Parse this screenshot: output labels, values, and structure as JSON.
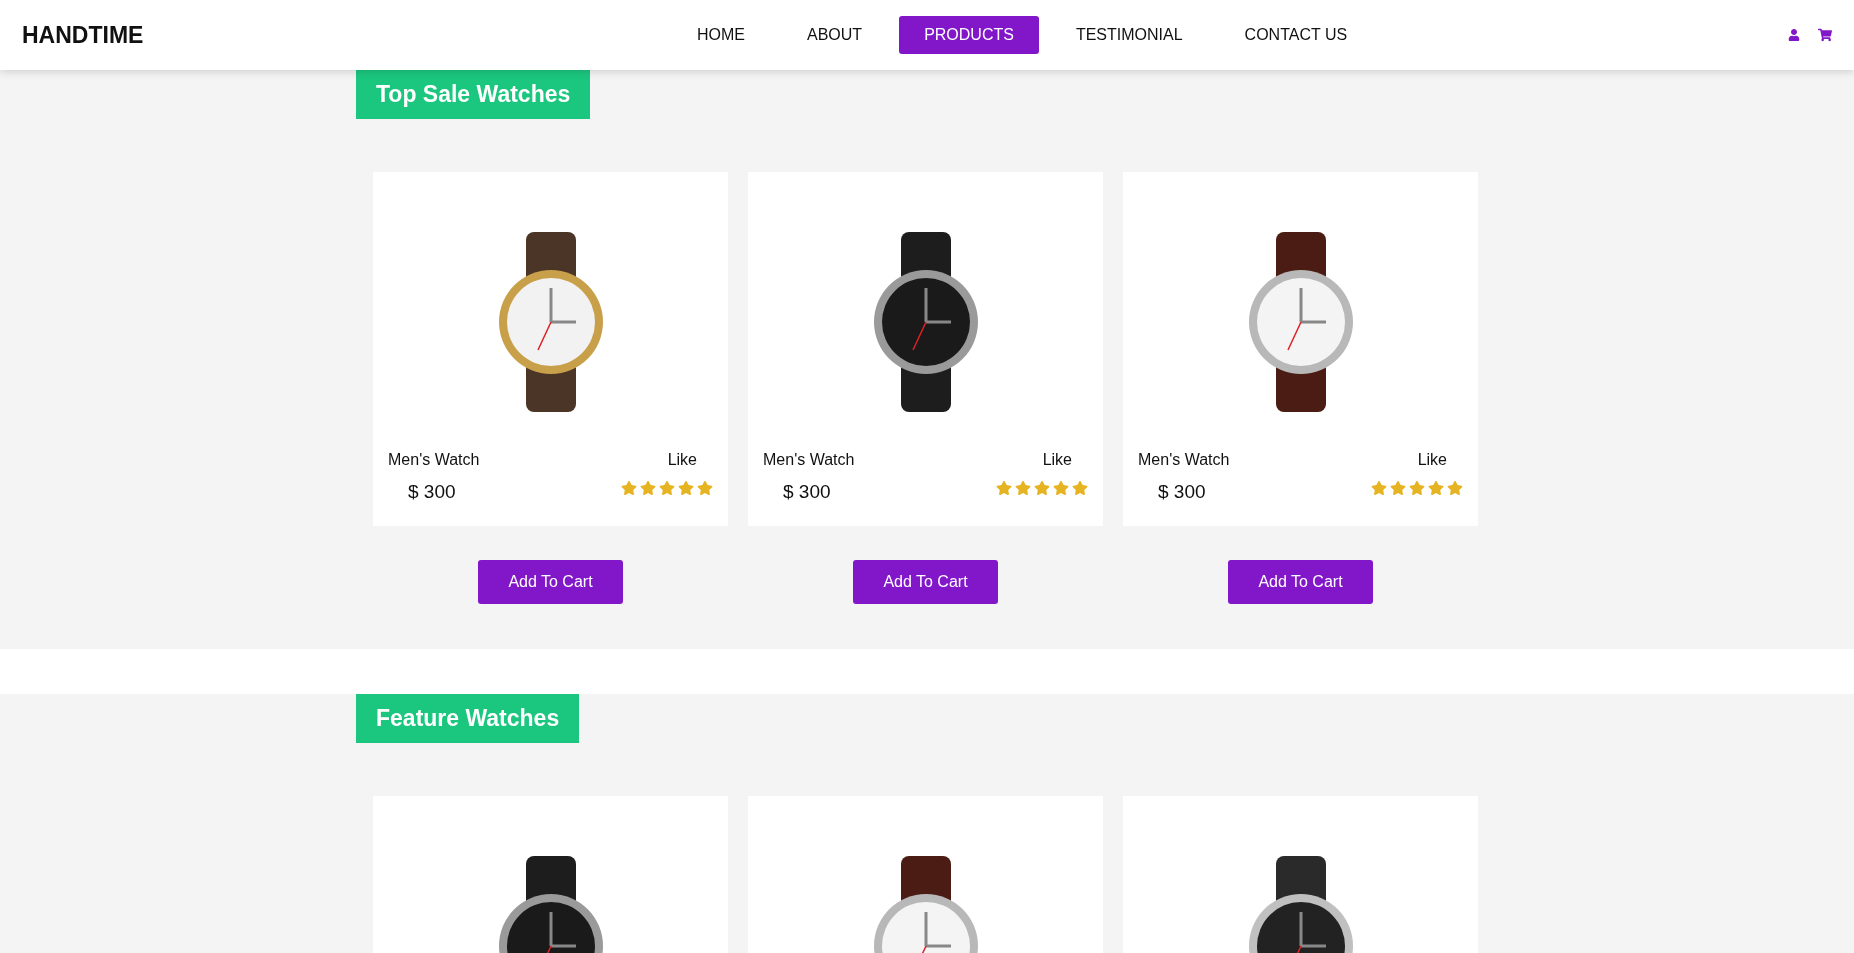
{
  "header": {
    "logo": "HANDTIME",
    "nav": [
      {
        "label": "HOME",
        "selected": false
      },
      {
        "label": "ABOUT",
        "selected": false
      },
      {
        "label": "PRODUCTS",
        "selected": true
      },
      {
        "label": "TESTIMONIAL",
        "selected": false
      },
      {
        "label": "CONTACT US",
        "selected": false
      }
    ]
  },
  "sections": [
    {
      "title": "Top Sale Watches",
      "products": [
        {
          "name": "Men's Watch",
          "price": "$ 300",
          "like": "Like",
          "stars": 5,
          "button": "Add To Cart",
          "kind": "gold"
        },
        {
          "name": "Men's Watch",
          "price": "$ 300",
          "like": "Like",
          "stars": 5,
          "button": "Add To Cart",
          "kind": "black"
        },
        {
          "name": "Men's Watch",
          "price": "$ 300",
          "like": "Like",
          "stars": 5,
          "button": "Add To Cart",
          "kind": "white"
        }
      ]
    },
    {
      "title": "Feature Watches",
      "products": [
        {
          "kind": "black"
        },
        {
          "kind": "white"
        },
        {
          "kind": "smart"
        }
      ]
    }
  ]
}
